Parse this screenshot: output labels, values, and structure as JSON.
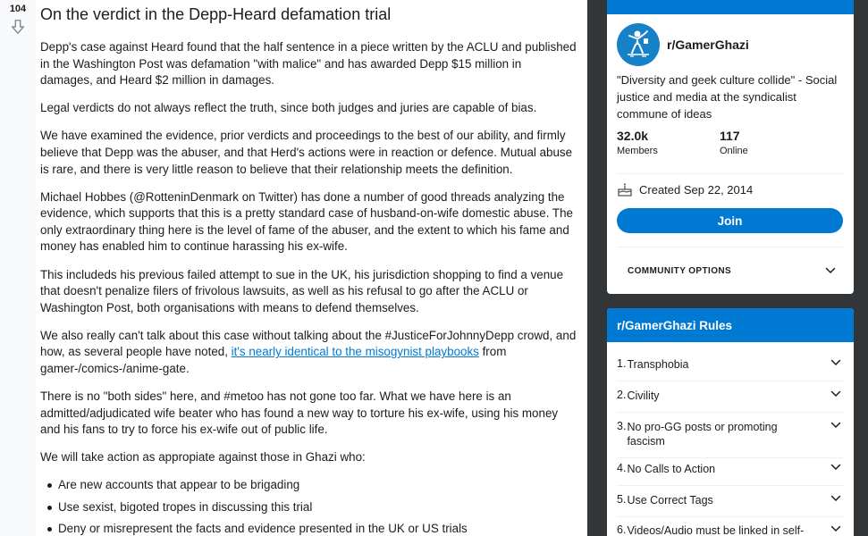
{
  "post": {
    "vote_count": "104",
    "title": "On the verdict in the Depp-Heard defamation trial",
    "paragraphs": [
      "Depp's case against Heard found that the half sentence in a piece written by the ACLU and published in the Washington Post was defamation \"with malice\" and has awarded Depp $15 million in damages, and Heard $2 million in damages.",
      "Legal verdicts do not always reflect the truth, since both judges and juries are capable of bias.",
      "We have examined the evidence, prior verdicts and proceedings to the best of our ability, and firmly believe that Depp was the abuser, and that Herd's actions were in reaction or defence. Mutual abuse is rare, and there is very little reason to believe that their relationship meets the definition.",
      "Michael Hobbes (@RotteninDenmark on Twitter) has done a number of good threads analyzing the evidence, which supports that this is a pretty standard case of husband-on-wife domestic abuse. The only extraordinary thing here is the level of fame of the abuser, and the extent to which his fame and money has enabled him to continue harassing his ex-wife.",
      "This includeds his previous failed attempt to sue in the UK, his jurisdiction shopping to find a venue that doesn't penalize filers of frivolous lawsuits, as well as his refusal to go after the ACLU or Washington Post, both organisations with means to defend themselves."
    ],
    "para_link": {
      "before": "We also really can't talk about this case without talking about the #JusticeForJohnnyDepp crowd, and how, as several people have noted, ",
      "link": "it's nearly identical to the misogynist playbooks",
      "after": " from gamer-/comics-/anime-gate."
    },
    "paragraphs2": [
      "There is no \"both sides\" here, and #metoo has not gone too far. What we have here is an admitted/adjudicated wife beater who has found a new way to torture his ex-wife, using his money and his fans to try to force his ex-wife out of public life.",
      "We will take action as appropiate against those in Ghazi who:"
    ],
    "bullets": [
      "Are new accounts that appear to be brigading",
      "Use sexist, bigoted tropes in discussing this trial",
      "Deny or misrepresent the facts and evidence presented in the UK or US trials"
    ]
  },
  "sidebar": {
    "subreddit_name": "r/GamerGhazi",
    "description": "\"Diversity and geek culture collide\" - Social justice and media at the syndicalist commune of ideas",
    "members_count": "32.0k",
    "members_label": "Members",
    "online_count": "117",
    "online_label": "Online",
    "created": "Created Sep 22, 2014",
    "join_label": "Join",
    "community_options_label": "COMMUNITY OPTIONS",
    "rules_title": "r/GamerGhazi Rules",
    "rules": [
      {
        "num": "1.",
        "label": "Transphobia"
      },
      {
        "num": "2.",
        "label": "Civility"
      },
      {
        "num": "3.",
        "label": "No pro-GG posts or promoting fascism"
      },
      {
        "num": "4.",
        "label": "No Calls to Action"
      },
      {
        "num": "5.",
        "label": "Use Correct Tags"
      },
      {
        "num": "6.",
        "label": "Videos/Audio must be linked in self-"
      }
    ]
  },
  "colors": {
    "accent": "#0079d3",
    "page_background": "#333638"
  }
}
